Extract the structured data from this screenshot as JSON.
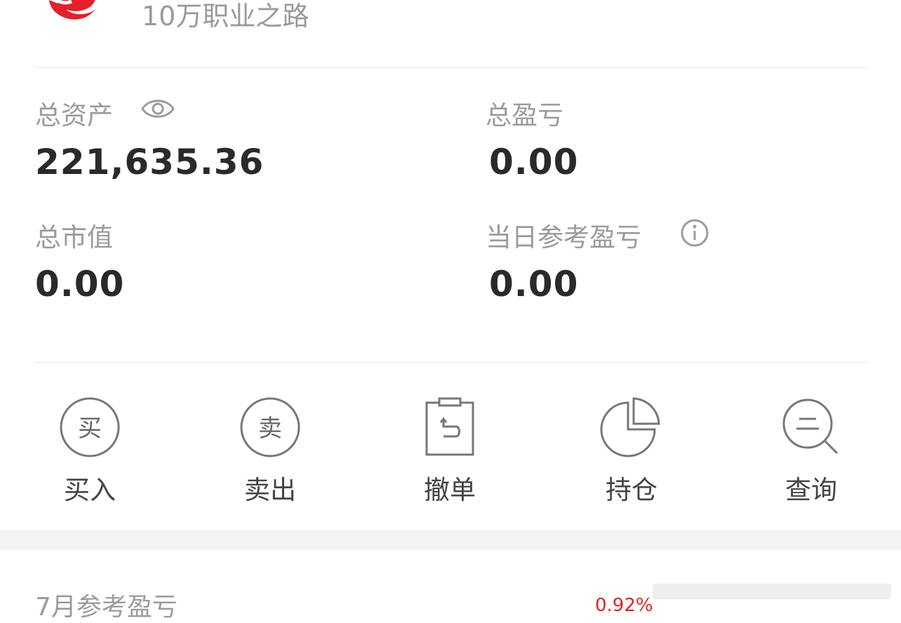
{
  "header": {
    "account_name": "10万职业之路",
    "logo_icon": "red-logo-icon",
    "brand_color": "#e4202a"
  },
  "summary": {
    "total_assets_label": "总资产",
    "total_assets_value": "221,635.36",
    "total_pnl_label": "总盈亏",
    "total_pnl_value": "0.00",
    "market_value_label": "总市值",
    "market_value_value": "0.00",
    "daily_ref_pnl_label": "当日参考盈亏",
    "daily_ref_pnl_value": "0.00",
    "eye_icon": "eye-icon",
    "info_icon": "info-icon"
  },
  "actions": [
    {
      "label": "买入",
      "glyph": "买",
      "icon": "buy-icon"
    },
    {
      "label": "卖出",
      "glyph": "卖",
      "icon": "sell-icon"
    },
    {
      "label": "撤单",
      "icon": "cancel-order-icon"
    },
    {
      "label": "持仓",
      "icon": "pie-chart-icon"
    },
    {
      "label": "查询",
      "icon": "search-icon"
    }
  ],
  "monthly": {
    "label": "7月参考盈亏",
    "percent": "0.92%",
    "percent_color": "#e52222"
  }
}
